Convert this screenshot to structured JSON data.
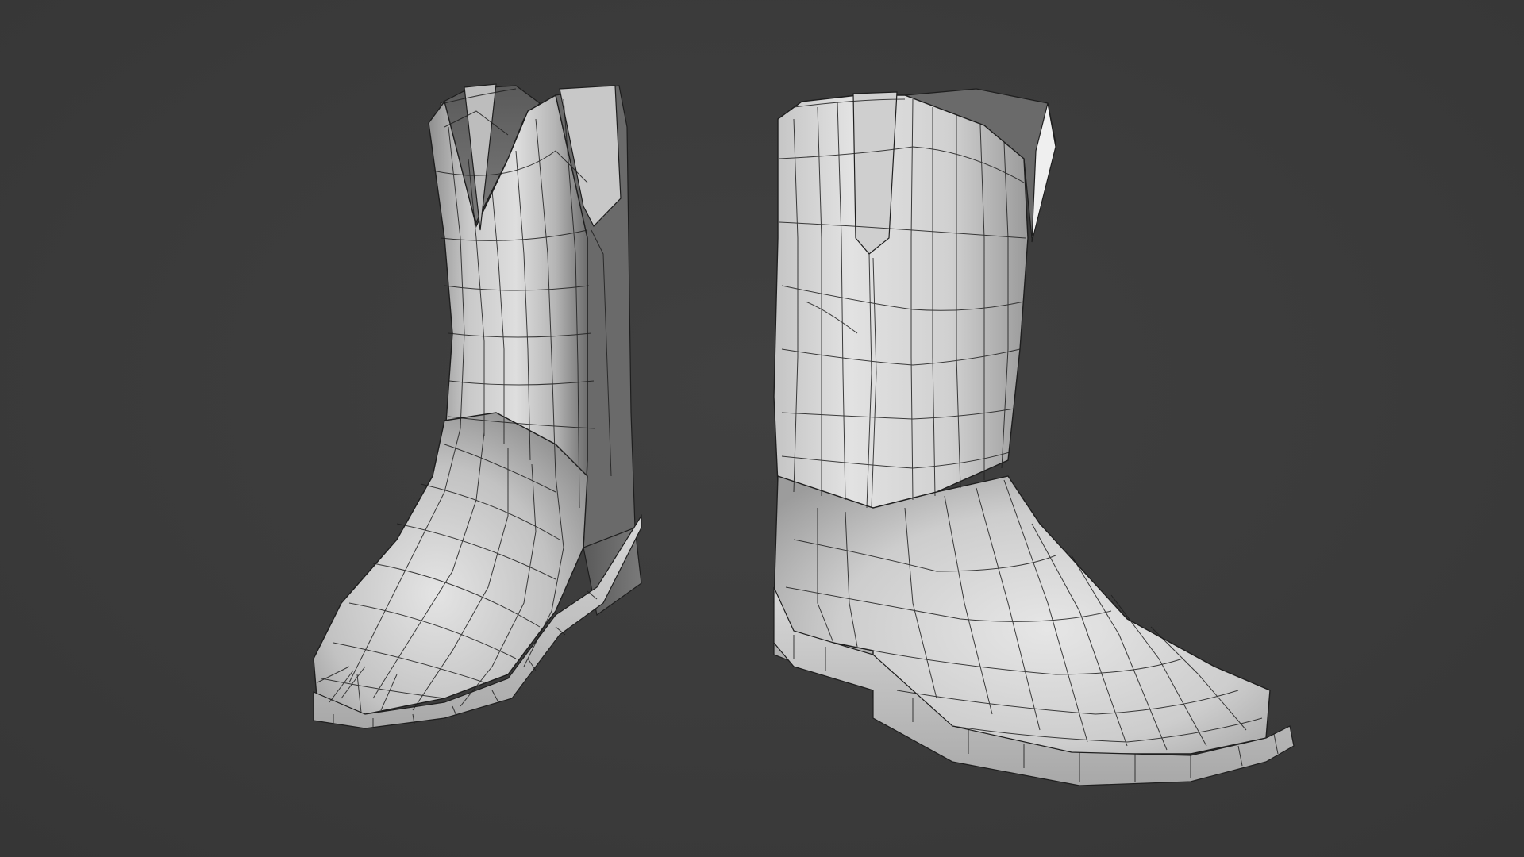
{
  "viewport": {
    "background_color": "#3a3a3a"
  },
  "scene": {
    "objects": [
      {
        "name": "left-boot",
        "shading": "solid-wireframe",
        "color": "#d2d2d2"
      },
      {
        "name": "right-boot",
        "shading": "solid-wireframe",
        "color": "#d2d2d2"
      }
    ],
    "wire_color": "#1e1e1e"
  }
}
